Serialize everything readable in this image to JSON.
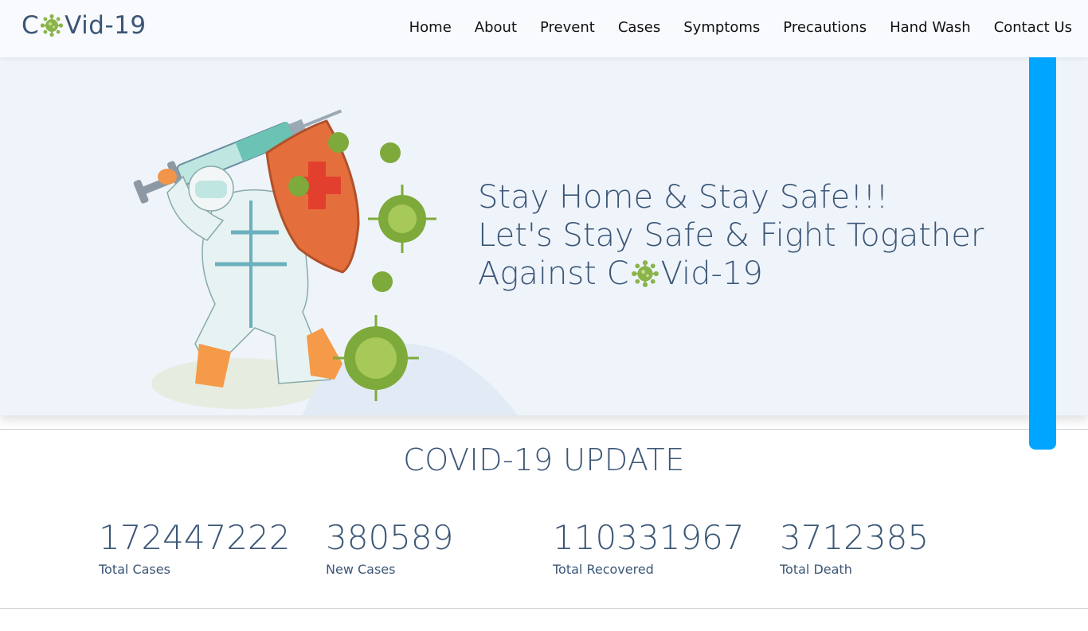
{
  "brand": {
    "prefix": "C",
    "suffix": "Vid-19",
    "accent": "#8ab44a"
  },
  "nav": [
    "Home",
    "About",
    "Prevent",
    "Cases",
    "Symptoms",
    "Precautions",
    "Hand Wash",
    "Contact Us"
  ],
  "hero": {
    "line1": "Stay Home & Stay Safe!!!",
    "line2": "Let's Stay Safe & Fight Togather",
    "line3_prefix": "Against C",
    "line3_suffix": "Vid-19"
  },
  "update": {
    "title": "COVID-19 UPDATE",
    "stats": [
      {
        "value": "172447222",
        "label": "Total Cases"
      },
      {
        "value": "380589",
        "label": "New Cases"
      },
      {
        "value": "110331967",
        "label": "Total Recovered"
      },
      {
        "value": "3712385",
        "label": "Total Death"
      }
    ]
  },
  "colors": {
    "text": "#3b5676",
    "hero_bg": "#eff4fb",
    "scroll_thumb": "#00a5ff"
  }
}
